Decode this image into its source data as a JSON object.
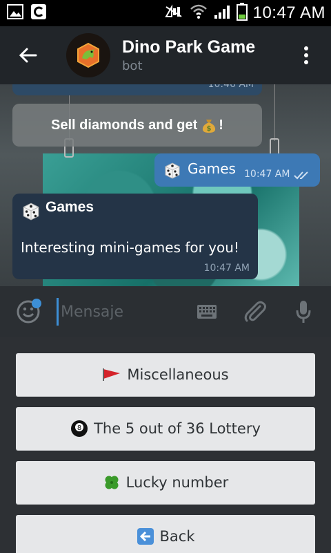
{
  "status": {
    "time": "10:47 AM"
  },
  "header": {
    "title": "Dino Park Game",
    "subtitle": "bot"
  },
  "messages": {
    "previous_time": "10:46 AM",
    "service": {
      "text": "Sell diamonds and get",
      "suffix": "!",
      "emoji": "money-bag-icon"
    },
    "outgoing": {
      "emoji": "dice-icon",
      "text": "Games",
      "time": "10:47 AM"
    },
    "incoming": {
      "emoji": "dice-icon",
      "title": "Games",
      "text": "Interesting mini-games for you!",
      "time": "10:47 AM"
    }
  },
  "input": {
    "placeholder": "Mensaje"
  },
  "keyboard": {
    "buttons": [
      {
        "label": "Miscellaneous",
        "emoji": "red-flag-icon"
      },
      {
        "label": "The 5 out of 36 Lottery",
        "emoji": "eight-ball-icon"
      },
      {
        "label": "Lucky number",
        "emoji": "four-leaf-clover-icon"
      },
      {
        "label": "Back",
        "emoji": "left-arrow-icon"
      }
    ]
  },
  "colors": {
    "header": "#212529",
    "outgoing_bubble": "#3d79b5",
    "incoming_bubble": "#243447",
    "accent": "#3d8fd6"
  }
}
